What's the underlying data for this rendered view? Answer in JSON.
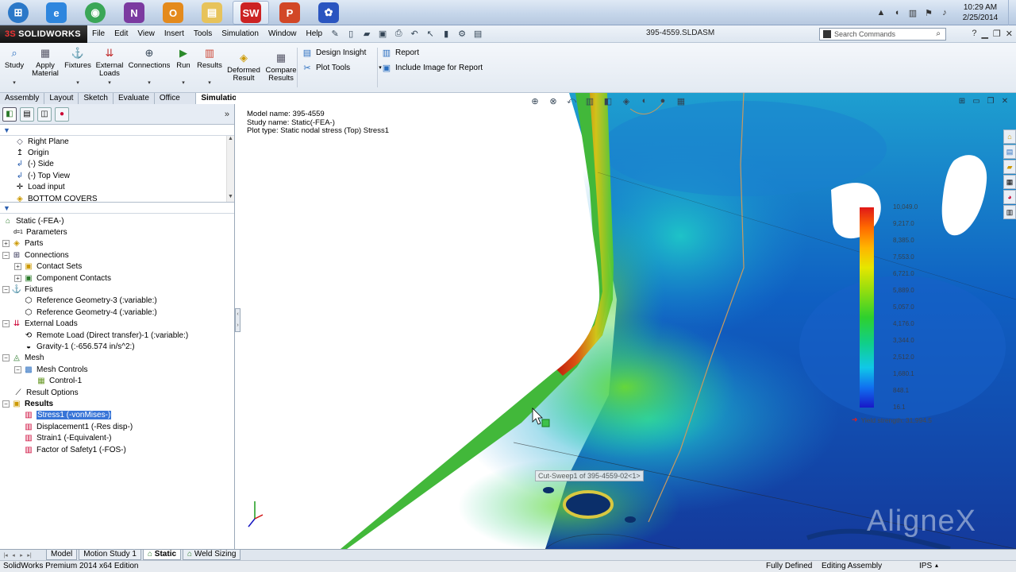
{
  "taskbar": {
    "apps": [
      {
        "name": "windows-start-icon",
        "glyph": "⊞",
        "bg": "#2b78c8"
      },
      {
        "name": "internet-explorer-icon",
        "glyph": "e",
        "bg": "#2e86de"
      },
      {
        "name": "chrome-icon",
        "glyph": "◉",
        "bg": "#3aa657"
      },
      {
        "name": "onenote-icon",
        "glyph": "N",
        "bg": "#7b3aa0"
      },
      {
        "name": "outlook-icon",
        "glyph": "O",
        "bg": "#e48a1c"
      },
      {
        "name": "file-explorer-icon",
        "glyph": "▤",
        "bg": "#e7c35b"
      },
      {
        "name": "solidworks-icon",
        "glyph": "SW",
        "bg": "#cc2222"
      },
      {
        "name": "powerpoint-icon",
        "glyph": "P",
        "bg": "#d24726"
      },
      {
        "name": "app-flower-icon",
        "glyph": "✿",
        "bg": "#2a55c0"
      }
    ],
    "clock_time": "10:29 AM",
    "clock_date": "2/25/2014"
  },
  "menubar": {
    "logo": "SOLIDWORKS",
    "items": [
      "File",
      "Edit",
      "View",
      "Insert",
      "Tools",
      "Simulation",
      "Window",
      "Help"
    ],
    "document_title": "395-4559.SLDASM",
    "search_placeholder": "Search Commands"
  },
  "command_manager": {
    "buttons": [
      {
        "label": "Study",
        "icon": "study-icon",
        "glyph": "🔍"
      },
      {
        "label": "Apply Material",
        "icon": "material-icon",
        "glyph": "▦"
      },
      {
        "label": "Fixtures",
        "icon": "fixtures-icon",
        "glyph": "⚓"
      },
      {
        "label": "External Loads",
        "icon": "loads-icon",
        "glyph": "⇊"
      },
      {
        "label": "Connections",
        "icon": "connections-icon",
        "glyph": "⊕"
      },
      {
        "label": "Run",
        "icon": "run-icon",
        "glyph": "▶"
      },
      {
        "label": "Results",
        "icon": "results-icon",
        "glyph": "▥"
      },
      {
        "label": "Deformed Result",
        "icon": "deformed-icon",
        "glyph": "◈"
      },
      {
        "label": "Compare Results",
        "icon": "compare-icon",
        "glyph": "▦"
      }
    ],
    "row_items": [
      {
        "label": "Design Insight"
      },
      {
        "label": "Plot Tools"
      },
      {
        "label": "Report"
      },
      {
        "label": "Include Image for Report"
      }
    ]
  },
  "cm_tabs": [
    "Assembly",
    "Layout",
    "Sketch",
    "Evaluate",
    "Office Products",
    "Simulation"
  ],
  "feature_tree": [
    "Right Plane",
    "Origin",
    "(-) Side",
    "(-) Top View",
    "Load input",
    "BOTTOM COVERS"
  ],
  "sim_tree": [
    {
      "label": "Static (-FEA-)"
    },
    {
      "label": "Parameters"
    },
    {
      "label": "Parts"
    },
    {
      "label": "Connections"
    },
    {
      "label": "Contact Sets"
    },
    {
      "label": "Component Contacts"
    },
    {
      "label": "Fixtures"
    },
    {
      "label": "Reference Geometry-3 (:variable:)"
    },
    {
      "label": "Reference Geometry-4 (:variable:)"
    },
    {
      "label": "External Loads"
    },
    {
      "label": "Remote Load (Direct transfer)-1 (:variable:)"
    },
    {
      "label": "Gravity-1 (:-656.574 in/s^2:)"
    },
    {
      "label": "Mesh"
    },
    {
      "label": "Mesh Controls"
    },
    {
      "label": "Control-1"
    },
    {
      "label": "Result Options"
    },
    {
      "label": "Results"
    },
    {
      "label": "Stress1 (-vonMises-)"
    },
    {
      "label": "Displacement1 (-Res disp-)"
    },
    {
      "label": "Strain1 (-Equivalent-)"
    },
    {
      "label": "Factor of Safety1 (-FOS-)"
    }
  ],
  "viewport": {
    "model_name": "Model name: 395-4559",
    "study_name": "Study name: Static(-FEA-)",
    "plot_type": "Plot type: Static nodal stress (Top) Stress1",
    "legend_values": [
      "10,049.0",
      "9,217.0",
      "8,385.0",
      "7,553.0",
      "6,721.0",
      "5,889.0",
      "5,057.0",
      "4,176.0",
      "3,344.0",
      "2,512.0",
      "1,680.1",
      "848.1",
      "16.1"
    ],
    "yield_strength": "Yield strength: 31,994.5",
    "tooltip": "Cut-Sweep1 of 395-4559-02<1>",
    "watermark": "AligneX"
  },
  "bottom_tabs": [
    "Model",
    "Motion Study 1",
    "Static",
    "Weld Sizing"
  ],
  "statusbar": {
    "product": "SolidWorks Premium 2014 x64 Edition",
    "state": "Fully Defined",
    "mode": "Editing Assembly",
    "units": "IPS"
  }
}
